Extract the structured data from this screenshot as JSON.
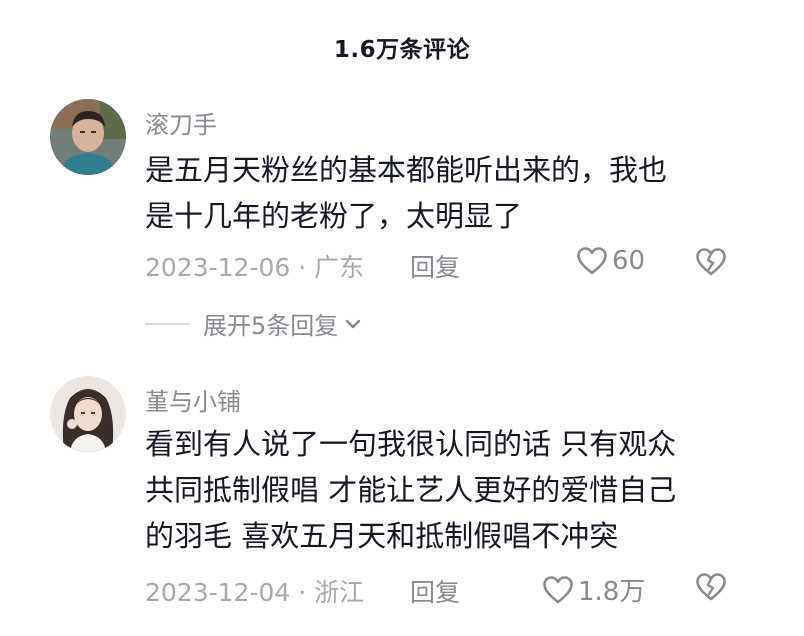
{
  "header": {
    "title": "1.6万条评论"
  },
  "comments": [
    {
      "username": "滚刀手",
      "text": "是五月天粉丝的基本都能听出来的，我也\n是十几年的老粉了，太明显了",
      "date": "2023-12-06",
      "location": "广东",
      "meta_sep": " · ",
      "reply_label": "回复",
      "likes": "60",
      "avatar_icon": "male-portrait-avatar"
    },
    {
      "username": "堇与小铺",
      "text": "看到有人说了一句我很认同的话 只有观众\n共同抵制假唱 才能让艺人更好的爱惜自己\n的羽毛 喜欢五月天和抵制假唱不冲突",
      "date": "2023-12-04",
      "location": "浙江",
      "meta_sep": " · ",
      "reply_label": "回复",
      "likes": "1.8万",
      "avatar_icon": "female-portrait-avatar"
    }
  ],
  "expand_replies": {
    "label": "展开5条回复"
  },
  "colors": {
    "primary_text": "#161823",
    "secondary_text": "#8a8b91",
    "meta_text": "#a8a9ae",
    "icon_stroke": "#8a8b91"
  }
}
